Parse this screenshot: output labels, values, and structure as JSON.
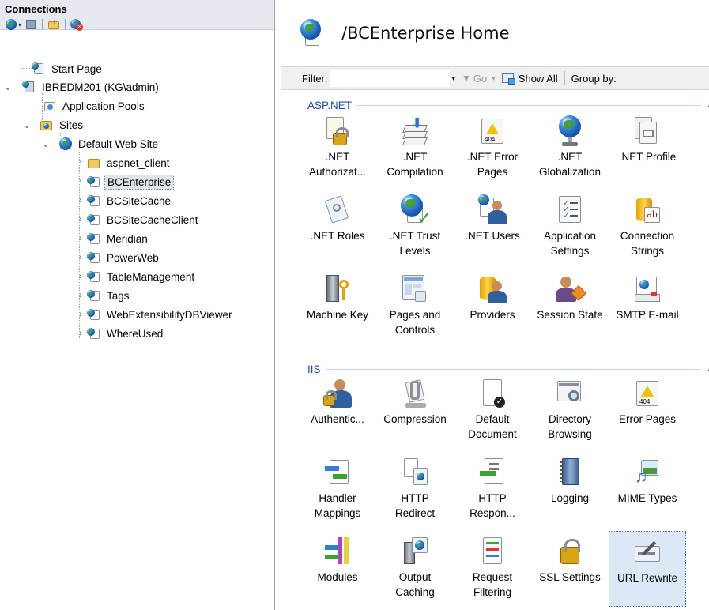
{
  "connections": {
    "title": "Connections",
    "tree": [
      {
        "label": "Start Page",
        "icon": "start-page-icon"
      },
      {
        "label": "IBREDM201 (KG\\admin)",
        "icon": "server-icon"
      },
      {
        "label": "Application Pools",
        "icon": "application-pools-icon"
      },
      {
        "label": "Sites",
        "icon": "sites-folder-icon"
      },
      {
        "label": "Default Web Site",
        "icon": "globe-icon"
      },
      {
        "label": "aspnet_client",
        "icon": "folder-icon"
      },
      {
        "label": "BCEnterprise",
        "icon": "web-app-icon"
      },
      {
        "label": "BCSiteCache",
        "icon": "web-app-icon"
      },
      {
        "label": "BCSiteCacheClient",
        "icon": "web-app-icon"
      },
      {
        "label": "Meridian",
        "icon": "web-app-icon"
      },
      {
        "label": "PowerWeb",
        "icon": "web-app-icon"
      },
      {
        "label": "TableManagement",
        "icon": "web-app-icon"
      },
      {
        "label": "Tags",
        "icon": "web-app-icon"
      },
      {
        "label": "WebExtensibilityDBViewer",
        "icon": "web-app-icon"
      },
      {
        "label": "WhereUsed",
        "icon": "web-app-icon"
      }
    ],
    "selected": "BCEnterprise"
  },
  "content": {
    "title": "/BCEnterprise Home",
    "filter": {
      "label": "Filter:",
      "value": "",
      "go_label": "Go",
      "show_all_label": "Show All",
      "group_by_label": "Group by:"
    },
    "groups": [
      {
        "name": "ASP.NET",
        "features": [
          {
            "line1": ".NET",
            "line2": "Authorizat...",
            "icon": "net-authorization-icon"
          },
          {
            "line1": ".NET",
            "line2": "Compilation",
            "icon": "net-compilation-icon"
          },
          {
            "line1": ".NET Error",
            "line2": "Pages",
            "icon": "net-error-pages-icon"
          },
          {
            "line1": ".NET",
            "line2": "Globalization",
            "icon": "net-globalization-icon"
          },
          {
            "line1": ".NET Profile",
            "line2": "",
            "icon": "net-profile-icon"
          },
          {
            "line1": ".NET Roles",
            "line2": "",
            "icon": "net-roles-icon"
          },
          {
            "line1": ".NET Trust",
            "line2": "Levels",
            "icon": "net-trust-levels-icon"
          },
          {
            "line1": ".NET Users",
            "line2": "",
            "icon": "net-users-icon"
          },
          {
            "line1": "Application",
            "line2": "Settings",
            "icon": "application-settings-icon"
          },
          {
            "line1": "Connection",
            "line2": "Strings",
            "icon": "connection-strings-icon"
          },
          {
            "line1": "Machine Key",
            "line2": "",
            "icon": "machine-key-icon"
          },
          {
            "line1": "Pages and",
            "line2": "Controls",
            "icon": "pages-and-controls-icon"
          },
          {
            "line1": "Providers",
            "line2": "",
            "icon": "providers-icon"
          },
          {
            "line1": "Session State",
            "line2": "",
            "icon": "session-state-icon"
          },
          {
            "line1": "SMTP E-mail",
            "line2": "",
            "icon": "smtp-email-icon"
          }
        ]
      },
      {
        "name": "IIS",
        "features": [
          {
            "line1": "Authentic...",
            "line2": "",
            "icon": "authentication-icon"
          },
          {
            "line1": "Compression",
            "line2": "",
            "icon": "compression-icon"
          },
          {
            "line1": "Default",
            "line2": "Document",
            "icon": "default-document-icon"
          },
          {
            "line1": "Directory",
            "line2": "Browsing",
            "icon": "directory-browsing-icon"
          },
          {
            "line1": "Error Pages",
            "line2": "",
            "icon": "error-pages-icon"
          },
          {
            "line1": "Handler",
            "line2": "Mappings",
            "icon": "handler-mappings-icon"
          },
          {
            "line1": "HTTP",
            "line2": "Redirect",
            "icon": "http-redirect-icon"
          },
          {
            "line1": "HTTP",
            "line2": "Respon...",
            "icon": "http-response-headers-icon"
          },
          {
            "line1": "Logging",
            "line2": "",
            "icon": "logging-icon"
          },
          {
            "line1": "MIME Types",
            "line2": "",
            "icon": "mime-types-icon"
          },
          {
            "line1": "Modules",
            "line2": "",
            "icon": "modules-icon"
          },
          {
            "line1": "Output",
            "line2": "Caching",
            "icon": "output-caching-icon"
          },
          {
            "line1": "Request",
            "line2": "Filtering",
            "icon": "request-filtering-icon"
          },
          {
            "line1": "SSL Settings",
            "line2": "",
            "icon": "ssl-settings-icon"
          },
          {
            "line1": "URL Rewrite",
            "line2": "",
            "icon": "url-rewrite-icon"
          }
        ]
      }
    ],
    "selected_feature": "URL Rewrite",
    "error_badge_text": "404",
    "colors": {
      "group_header": "#1f4e9c",
      "selection": "#dde8f6",
      "panel_header": "#e6eaf0"
    }
  }
}
